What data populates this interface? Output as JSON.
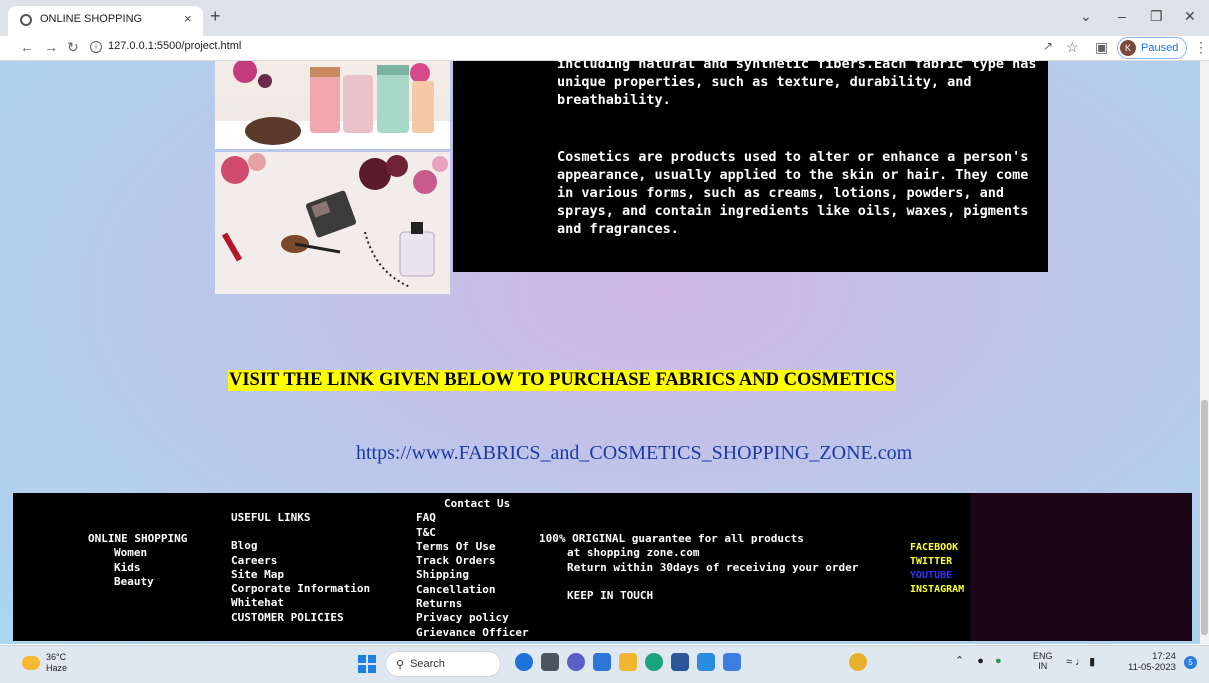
{
  "browser": {
    "tab_title": "ONLINE SHOPPING",
    "tab_close": "×",
    "new_tab": "+",
    "url": "127.0.0.1:5500/project.html",
    "profile_initial": "K",
    "profile_status": "Paused"
  },
  "content": {
    "paragraph_fabrics": "including natural and synthetic fibers.Each fabric type has unique properties, such as texture, durability, and breathability.",
    "paragraph_cosmetics": "Cosmetics are products used to alter or enhance a person's appearance, usually applied to the skin or hair. They come in various forms, such as creams, lotions, powders, and sprays, and contain ingredients like oils, waxes, pigments and fragrances.",
    "visit_heading": "VISIT THE LINK GIVEN BELOW TO PURCHASE FABRICS AND COSMETICS",
    "shop_link": "https://www.FABRICS_and_COSMETICS_SHOPPING_ZONE.com"
  },
  "footer": {
    "shop_title": "ONLINE SHOPPING",
    "shop_items": [
      "Women",
      "Kids",
      "Beauty"
    ],
    "useful_title": "USEFUL LINKS",
    "useful_items": [
      "Blog",
      "Careers",
      "Site Map",
      "Corporate Information",
      "Whitehat",
      "CUSTOMER POLICIES"
    ],
    "contact_title": "Contact Us",
    "contact_items": [
      "FAQ",
      "T&C",
      "Terms Of Use",
      "Track Orders",
      "Shipping",
      "Cancellation",
      "Returns",
      "Privacy policy",
      "Grievance Officer"
    ],
    "guarantee_line1": "100% ORIGINAL guarantee for all products",
    "guarantee_line2": "at shopping zone.com",
    "guarantee_line3": "Return within 30days of receiving your order",
    "keep_in_touch": "KEEP IN TOUCH",
    "social": [
      "FACEBOOK",
      "TWITTER",
      "YOUTUBE",
      "INSTAGRAM"
    ],
    "social_colors": [
      "#ffff33",
      "#ffff33",
      "#3333ff",
      "#ffff33"
    ]
  },
  "taskbar": {
    "temperature": "36°C",
    "weather": "Haze",
    "search_label": "Search",
    "lang_line1": "ENG",
    "lang_line2": "IN",
    "time": "17:24",
    "date": "11-05-2023",
    "notification_count": "5"
  }
}
